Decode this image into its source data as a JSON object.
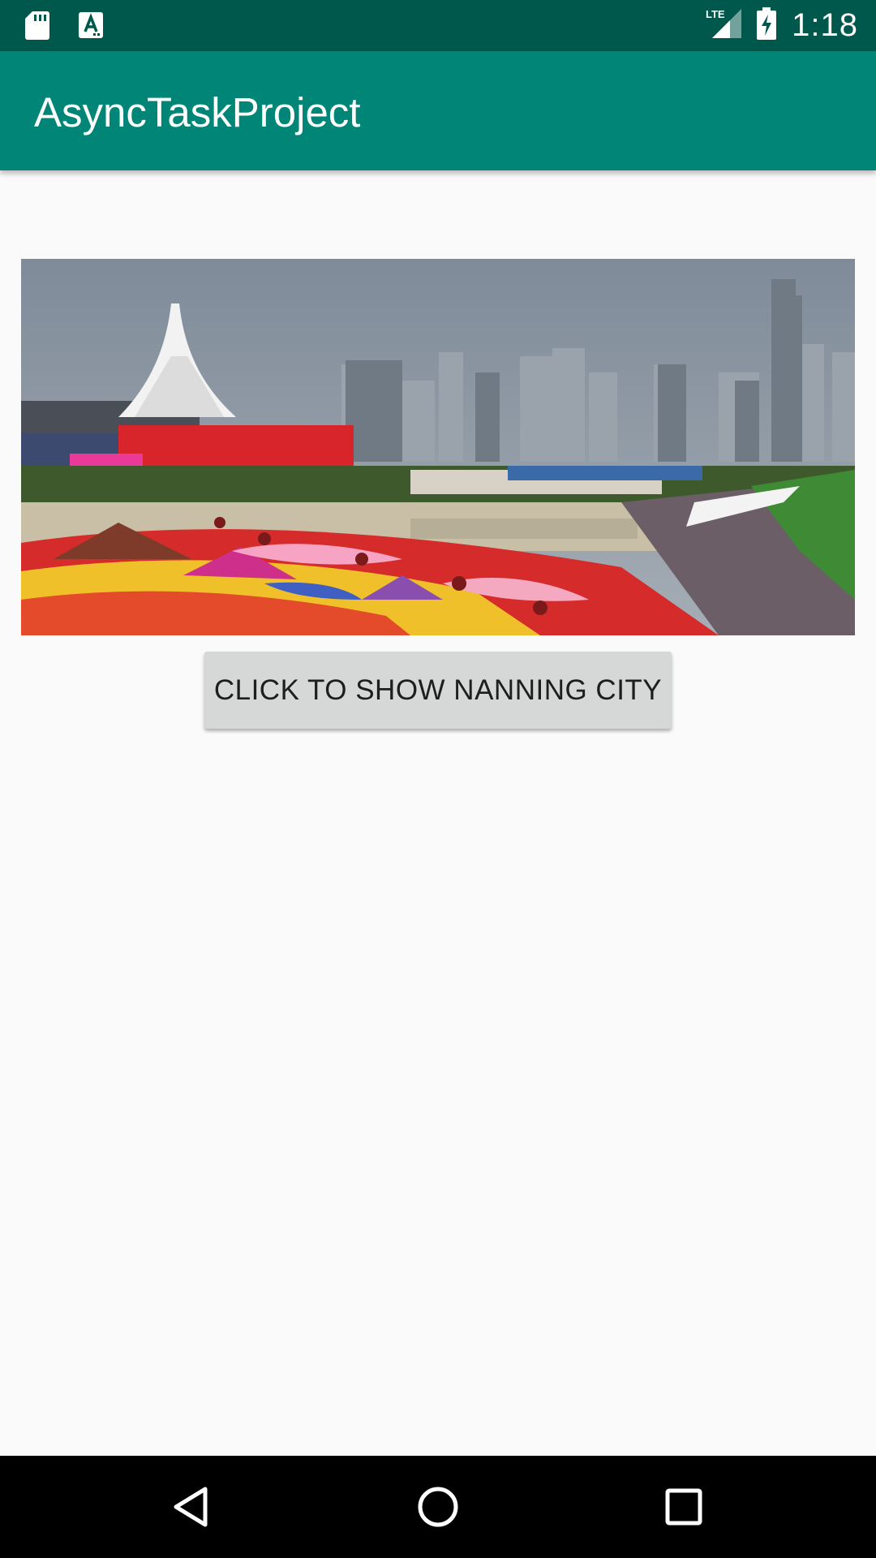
{
  "status_bar": {
    "time": "1:18",
    "network": "LTE",
    "icons": [
      "sd-card-icon",
      "a-notification-icon",
      "lte-signal-icon",
      "battery-charging-icon"
    ]
  },
  "app_bar": {
    "title": "AsyncTaskProject",
    "color": "#008577"
  },
  "main": {
    "image_description_icon": "city-photo",
    "button_label": "CLICK TO SHOW NANNING CITY"
  },
  "nav_bar": {
    "icons": [
      "back-icon",
      "home-icon",
      "recents-icon"
    ]
  },
  "colors": {
    "status_bar": "#00574b",
    "app_bar": "#008577",
    "background": "#fafafa",
    "button": "#d6d7d7"
  }
}
